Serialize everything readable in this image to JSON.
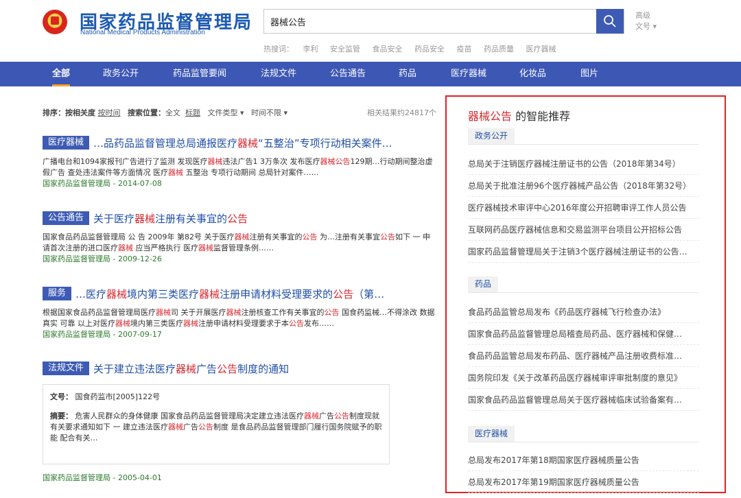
{
  "header": {
    "logo_cn": "国家药品监督管理局",
    "logo_en": "National Medical Products Administration",
    "search_value": "器械公告",
    "adv_line1": "高级",
    "adv_line2": "文号 ▾",
    "hot_label": "热搜词：",
    "hot_words": [
      "李利",
      "安全监管",
      "食品安全",
      "药品安全",
      "疫苗",
      "药品质量",
      "医疗器械"
    ]
  },
  "nav": [
    "全部",
    "政务公开",
    "药品监管要闻",
    "法规文件",
    "公告通告",
    "药品",
    "医疗器械",
    "化妆品",
    "图片"
  ],
  "filter": {
    "sort_label": "排序：",
    "sort_rel": "按相关度",
    "sort_time": "按时间",
    "pos_label": "搜索位置：",
    "pos_all": "全文",
    "pos_title": "标题",
    "doctype": "文件类型 ▾",
    "timelimit": "时间不限 ▾",
    "count": "相关结果约24817个"
  },
  "results": [
    {
      "tag": "医疗器械",
      "title_parts": [
        "…品药品监督管理总局通报医疗",
        "器械",
        "“五整治”专项行动相关案件…"
      ],
      "desc_parts": [
        "广播电台和1094家报刊广告进行了监测 发现医疗",
        "器械",
        "违法广告1 3万条次 发布医疗",
        "器械公告",
        "129期…行动期间整治虚假广告 查处违法案件等方面情况 医疗",
        "器械",
        " 五整治 专项行动期间 总局针对案件……"
      ],
      "source": "国家药品监督管理局 - 2014-07-08"
    },
    {
      "tag": "公告通告",
      "title_parts": [
        "关于医疗",
        "器械",
        "注册有关事宜的",
        "公告",
        ""
      ],
      "desc_parts": [
        "国家食品药品监督管理局 公 告 2009年 第82号 关于医疗",
        "器械",
        "注册有关事宜的",
        "公告",
        " 为…注册有关事宜",
        "公告",
        "如下 一 申请首次注册的进口医疗",
        "器械",
        " 应当严格执行 医疗",
        "器械",
        "监督管理条例……"
      ],
      "source": "国家药品监督管理局 - 2009-12-26"
    },
    {
      "tag": "服务",
      "title_parts": [
        "…医疗",
        "器械",
        "境内第三类医疗",
        "器械",
        "注册申请材料受理要求的",
        "公告",
        "（第…"
      ],
      "desc_parts": [
        "根据国家食品药品监督管理局医疗",
        "器械",
        "司 关于开展医疗",
        "器械",
        "注册核查工作有关事宜的",
        "公告",
        " 国食药监械…不得涂改 数据真实 可靠 以上对医疗",
        "器械",
        "境内第三类医疗",
        "器械",
        "注册申请材料受理要求于本",
        "公告",
        "发布……"
      ],
      "source": "国家药品监督管理局 - 2007-09-17"
    },
    {
      "tag": "法规文件",
      "title_parts": [
        "关于建立违法医疗",
        "器械",
        "广告",
        "公告",
        "制度的通知"
      ],
      "docno_label": "文号：",
      "docno": "国食药监市[2005]122号",
      "abs_label": "摘要：",
      "abs_parts": [
        "危害人民群众的身体健康 国家食品药品监督管理局决定建立违法医疗",
        "器械",
        "广告",
        "公告",
        "制度现就有关要求通知如下 一 建立违法医疗",
        "器械",
        "广告",
        "公告",
        "制度 是食品药品监督管理部门履行国务院赋予的职能 配合有关…"
      ],
      "source": "国家药品监督管理局 - 2005-04-01"
    }
  ],
  "side": {
    "title_hl": "器械公告",
    "title_rest": " 的智能推荐",
    "groups": [
      {
        "name": "政务公开",
        "links": [
          "总局关于注销医疗器械注册证书的公告（2018年第34号）",
          "总局关于批准注册96个医疗器械产品公告（2018年第32号）",
          "医疗器械技术审评中心2016年度公开招聘审评工作人员公告",
          "互联网药品医疗器械信息和交易监测平台项目公开招标公告",
          "国家药品监督管理局关于注销3个医疗器械注册证书的公告…"
        ]
      },
      {
        "name": "药品",
        "links": [
          "食品药品监管总局发布《药品医疗器械飞行检查办法》",
          "国家食品药品监督管理总局稽查局药品、医疗器械和保健…",
          "食品药品监管总局发布药品、医疗器械产品注册收费标准…",
          "国务院印发《关于改革药品医疗器械审评审批制度的意见》",
          "国家食品药品监督管理总局关于医疗器械临床试验备案有…"
        ]
      },
      {
        "name": "医疗器械",
        "links": [
          "总局发布2017年第18期国家医疗器械质量公告",
          "总局发布2017年第19期国家医疗器械质量公告"
        ]
      }
    ]
  },
  "colors": {
    "nav_bg": "#3d57b5",
    "highlight": "#d7282f",
    "link": "#1f4ea6",
    "source": "#2c7a2c",
    "box": "#e02020"
  },
  "icons": {
    "search": "search-icon",
    "logo": "emblem-icon"
  }
}
